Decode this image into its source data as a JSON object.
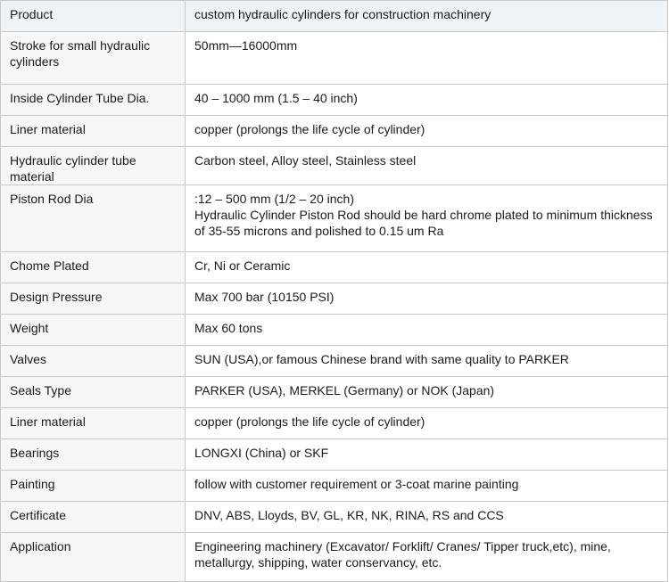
{
  "rows": [
    {
      "label": "Product",
      "value": "custom hydraulic cylinders for construction machinery",
      "height": 35
    },
    {
      "label": "Stroke for small hydraulic cylinders",
      "value": "50mm—16000mm",
      "height": 59
    },
    {
      "label": "Inside Cylinder Tube Dia.",
      "value": "40 – 1000 mm (1.5 – 40 inch)",
      "height": 35
    },
    {
      "label": "Liner material",
      "value": "copper (prolongs the life cycle of cylinder)",
      "height": 35
    },
    {
      "label": "Hydraulic cylinder tube material",
      "value": "Carbon steel, Alloy steel, Stainless steel",
      "height": 35
    },
    {
      "label": "Piston Rod Dia",
      "value": ":12 – 500 mm (1/2 – 20 inch)\n Hydraulic Cylinder Piston Rod should be hard chrome plated to minimum thickness of 35-55 microns and polished to 0.15 um Ra",
      "height": 75
    },
    {
      "label": "Chome Plated",
      "value": "Cr, Ni or Ceramic",
      "height": 35
    },
    {
      "label": "Design Pressure",
      "value": "Max 700 bar (10150 PSI)",
      "height": 35
    },
    {
      "label": "Weight",
      "value": "Max 60 tons",
      "height": 35
    },
    {
      "label": "Valves",
      "value": "SUN (USA),or famous Chinese brand with same quality to PARKER",
      "height": 35
    },
    {
      "label": "Seals Type",
      "value": "PARKER (USA), MERKEL (Germany) or NOK (Japan)",
      "height": 35
    },
    {
      "label": "Liner material",
      "value": "copper (prolongs the life cycle of cylinder)",
      "height": 35
    },
    {
      "label": "Bearings",
      "value": "LONGXI (China) or SKF",
      "height": 35
    },
    {
      "label": "Painting",
      "value": "follow with customer requirement or 3-coat marine painting",
      "height": 35
    },
    {
      "label": "Certificate",
      "value": "DNV, ABS, Lloyds, BV, GL, KR, NK, RINA, RS and CCS",
      "height": 35
    },
    {
      "label": "Application",
      "value": "Engineering machinery (Excavator/ Forklift/ Cranes/ Tipper truck,etc), mine, metallurgy, shipping, water conservancy, etc.",
      "height": 55
    }
  ]
}
